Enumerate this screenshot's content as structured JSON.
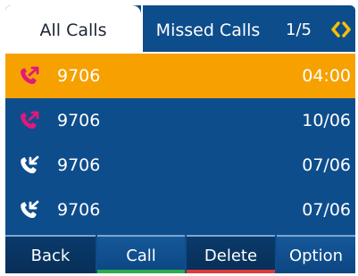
{
  "tabs": {
    "all_calls": "All Calls",
    "missed_calls": "Missed Calls",
    "page_indicator": "1/5"
  },
  "calls": [
    {
      "number": "9706",
      "time": "04:00",
      "type": "outgoing",
      "icon": "outgoing-call-icon",
      "icon_color": "#e0197d",
      "selected": true
    },
    {
      "number": "9706",
      "time": "10/06",
      "type": "outgoing",
      "icon": "outgoing-call-icon",
      "icon_color": "#e0197d",
      "selected": false
    },
    {
      "number": "9706",
      "time": "07/06",
      "type": "incoming",
      "icon": "incoming-call-icon",
      "icon_color": "#ffffff",
      "selected": false
    },
    {
      "number": "9706",
      "time": "07/06",
      "type": "incoming",
      "icon": "incoming-call-icon",
      "icon_color": "#ffffff",
      "selected": false
    }
  ],
  "softkeys": {
    "back": "Back",
    "call": "Call",
    "delete": "Delete",
    "option": "Option"
  },
  "colors": {
    "background": "#0e4d8c",
    "selected_row": "#f6a100",
    "arrow_accent": "#f6c000",
    "call_accent": "#2eab4a",
    "delete_accent": "#e03a3a"
  }
}
